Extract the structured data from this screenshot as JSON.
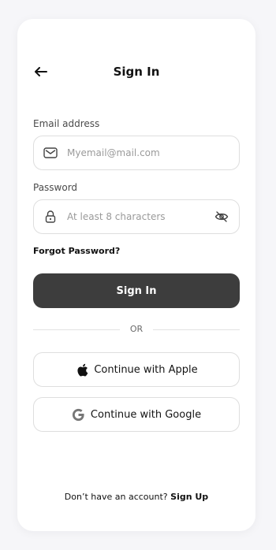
{
  "header": {
    "title": "Sign In",
    "back_icon": "arrow-left-icon"
  },
  "form": {
    "email": {
      "label": "Email address",
      "placeholder": "Myemail@mail.com",
      "icon": "mail-icon"
    },
    "password": {
      "label": "Password",
      "placeholder": "At least 8 characters",
      "lead_icon": "lock-icon",
      "toggle_icon": "eye-off-icon"
    },
    "forgot_label": "Forgot Password?",
    "submit_label": "Sign In"
  },
  "divider": {
    "label": "OR"
  },
  "social": {
    "apple_label": "Continue with Apple",
    "google_label": "Continue with Google"
  },
  "footer": {
    "prompt": "Don’t have an account?",
    "signup_label": "Sign Up"
  },
  "colors": {
    "background": "#f6f6f9",
    "card": "#ffffff",
    "primary_button": "#3d3d3d",
    "border": "#dedede",
    "text": "#111111",
    "muted_text": "#9a9a9a"
  }
}
